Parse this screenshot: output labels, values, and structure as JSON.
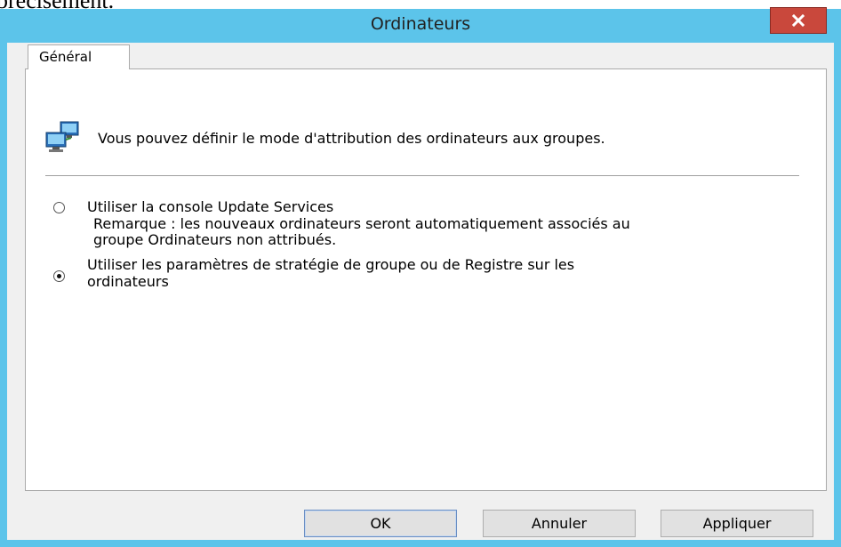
{
  "background_fragment": "précisément.",
  "window": {
    "title": "Ordinateurs",
    "close_glyph": "×"
  },
  "tabs": [
    {
      "label": "Général",
      "selected": true
    }
  ],
  "panel": {
    "header_icon": "computers-network-icon",
    "intro_text": "Vous pouvez définir le mode d'attribution des ordinateurs aux groupes.",
    "options": [
      {
        "label": "Utiliser la console Update Services",
        "selected": false,
        "remark_line1": "Remarque : les nouveaux ordinateurs seront automatiquement associés au",
        "remark_line2": "groupe Ordinateurs non attribués."
      },
      {
        "label_line1": "Utiliser les paramètres de stratégie de groupe ou de Registre sur les",
        "label_line2": "ordinateurs",
        "selected": true
      }
    ]
  },
  "buttons": {
    "ok": "OK",
    "cancel": "Annuler",
    "apply": "Appliquer"
  },
  "colors": {
    "title_bar": "#5cc4ea",
    "close_button": "#c9483c"
  }
}
